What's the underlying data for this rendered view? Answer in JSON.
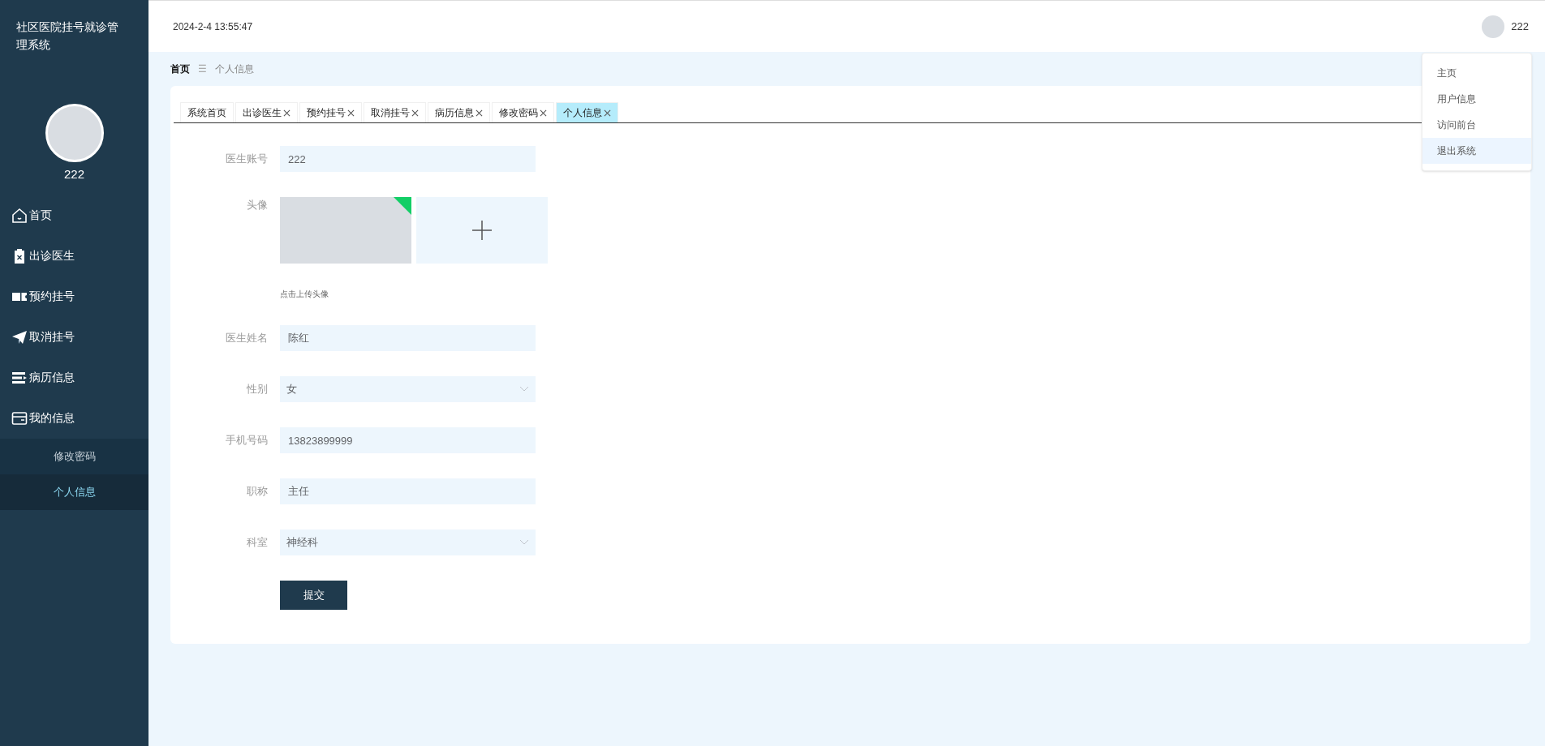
{
  "sidebar": {
    "title": "社区医院挂号就诊管理系统",
    "user_name": "222",
    "menu": [
      {
        "label": "首页"
      },
      {
        "label": "出诊医生"
      },
      {
        "label": "预约挂号"
      },
      {
        "label": "取消挂号"
      },
      {
        "label": "病历信息"
      },
      {
        "label": "我的信息",
        "children": [
          {
            "label": "修改密码",
            "selected": false
          },
          {
            "label": "个人信息",
            "selected": true
          }
        ]
      }
    ]
  },
  "header": {
    "datetime": "2024-2-4 13:55:47",
    "user_name": "222"
  },
  "user_menu": [
    {
      "label": "主页",
      "selected": false
    },
    {
      "label": "用户信息",
      "selected": false
    },
    {
      "label": "访问前台",
      "selected": false
    },
    {
      "label": "退出系统",
      "selected": true
    }
  ],
  "breadcrumb": {
    "home": "首页",
    "separator": "☰",
    "current": "个人信息"
  },
  "tabs": [
    {
      "label": "系统首页",
      "closable": false,
      "selected": false
    },
    {
      "label": "出诊医生",
      "closable": true,
      "selected": false
    },
    {
      "label": "预约挂号",
      "closable": true,
      "selected": false
    },
    {
      "label": "取消挂号",
      "closable": true,
      "selected": false
    },
    {
      "label": "病历信息",
      "closable": true,
      "selected": false
    },
    {
      "label": "修改密码",
      "closable": true,
      "selected": false
    },
    {
      "label": "个人信息",
      "closable": true,
      "selected": true
    }
  ],
  "form": {
    "fields": [
      {
        "kind": "text",
        "label": "医生账号",
        "value": "222"
      },
      {
        "kind": "upload",
        "label": "头像",
        "hint": "点击上传头像",
        "uploaded": true
      },
      {
        "kind": "text",
        "label": "医生姓名",
        "value": "陈红"
      },
      {
        "kind": "select",
        "label": "性别",
        "value": "女"
      },
      {
        "kind": "text",
        "label": "手机号码",
        "value": "13823899999"
      },
      {
        "kind": "text",
        "label": "职称",
        "value": "主任"
      },
      {
        "kind": "select",
        "label": "科室",
        "value": "神经科"
      }
    ],
    "submit": "提交"
  }
}
